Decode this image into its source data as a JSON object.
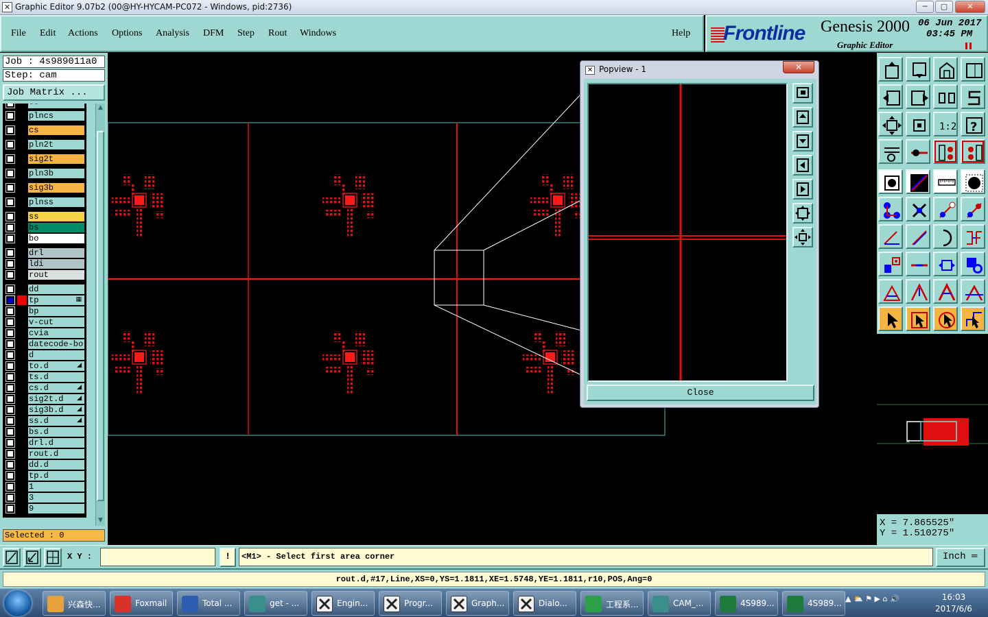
{
  "window": {
    "title": "Graphic Editor 9.07b2 (00@HY-HYCAM-PC072 - Windows, pid:2736)",
    "minimize": "─",
    "maximize": "▢",
    "close": "✕"
  },
  "menu": {
    "items": [
      "File",
      "Edit",
      "Actions",
      "Options",
      "Analysis",
      "DFM",
      "Step",
      "Rout",
      "Windows"
    ],
    "help": "Help"
  },
  "logo": {
    "brand": "Frontline",
    "product": "Genesis 2000",
    "subtitle": "Graphic Editor",
    "date": "06 Jun 2017",
    "time": "03:45 PM"
  },
  "job": {
    "job_line": "Job : 4s989011a0",
    "step_line": "Step: cam",
    "matrix_button": "Job Matrix ..."
  },
  "layers": [
    {
      "name": "--",
      "color": "#9fd8d2"
    },
    {
      "name": "plncs",
      "color": "#9fd8d2"
    },
    {
      "name": "cs",
      "color": "#f6b445"
    },
    {
      "name": "pln2t",
      "color": "#9fd8d2"
    },
    {
      "name": "sig2t",
      "color": "#f6b445"
    },
    {
      "name": "pln3b",
      "color": "#9fd8d2"
    },
    {
      "name": "sig3b",
      "color": "#f6b445"
    },
    {
      "name": "plnss",
      "color": "#9fd8d2"
    },
    {
      "name": "ss",
      "color": "#f6d445"
    },
    {
      "name": "bs",
      "color": "#008b6b"
    },
    {
      "name": "bo",
      "color": "#ffffff"
    },
    {
      "name": "drl",
      "color": "#b0c4c8"
    },
    {
      "name": "ldi",
      "color": "#b0c4c8"
    },
    {
      "name": "rout",
      "color": "#d8e0e0"
    },
    {
      "name": "dd",
      "color": "#9fd8d2"
    },
    {
      "name": "tp",
      "color": "#9fd8d2",
      "selected": true,
      "mark": "▦"
    },
    {
      "name": "bp",
      "color": "#9fd8d2"
    },
    {
      "name": "v-cut",
      "color": "#9fd8d2"
    },
    {
      "name": "cvia",
      "color": "#9fd8d2"
    },
    {
      "name": "datecode-bo",
      "color": "#9fd8d2"
    },
    {
      "name": "d",
      "color": "#9fd8d2"
    },
    {
      "name": "to.d",
      "color": "#9fd8d2",
      "mark": "◢"
    },
    {
      "name": "ts.d",
      "color": "#9fd8d2"
    },
    {
      "name": "cs.d",
      "color": "#9fd8d2",
      "mark": "◢"
    },
    {
      "name": "sig2t.d",
      "color": "#9fd8d2",
      "mark": "◢"
    },
    {
      "name": "sig3b.d",
      "color": "#9fd8d2",
      "mark": "◢"
    },
    {
      "name": "ss.d",
      "color": "#9fd8d2",
      "mark": "◢"
    },
    {
      "name": "bs.d",
      "color": "#9fd8d2"
    },
    {
      "name": "drl.d",
      "color": "#9fd8d2"
    },
    {
      "name": "rout.d",
      "color": "#9fd8d2"
    },
    {
      "name": "dd.d",
      "color": "#9fd8d2"
    },
    {
      "name": "tp.d",
      "color": "#9fd8d2"
    },
    {
      "name": "1",
      "color": "#9fd8d2"
    },
    {
      "name": "3",
      "color": "#9fd8d2"
    },
    {
      "name": "9",
      "color": "#9fd8d2"
    }
  ],
  "selected_count": "Selected : 0",
  "popview": {
    "title": "Popview - 1",
    "close_button": "Close",
    "close_x": "✕"
  },
  "coords": {
    "x": "X = 7.865525\"",
    "y": "Y = 1.510275\""
  },
  "command": {
    "xy_label": "X Y :",
    "xy_value": "",
    "bang": "!",
    "prompt": "<M1> - Select first area corner",
    "unit": "Inch ═"
  },
  "status": "rout.d,#17,Line,XS=0,YS=1.1811,XE=1.5748,YE=1.1811,r10,POS,Ang=0",
  "taskbar": {
    "tasks": [
      {
        "label": "兴森快...",
        "icon": "shell-icon",
        "color": "#e8a23a"
      },
      {
        "label": "Foxmail",
        "icon": "foxmail-icon",
        "color": "#d8322a"
      },
      {
        "label": "Total ...",
        "icon": "floppy-icon",
        "color": "#2d5fb0"
      },
      {
        "label": "get - ...",
        "icon": "eye-icon",
        "color": "#3a8f8a"
      },
      {
        "label": "Engin...",
        "icon": "xwin-icon",
        "color": "#f0f0f0"
      },
      {
        "label": "Progr...",
        "icon": "xwin-icon",
        "color": "#f0f0f0"
      },
      {
        "label": "Graph...",
        "icon": "xwin-icon",
        "color": "#f0f0f0"
      },
      {
        "label": "Dialo...",
        "icon": "xwin-icon",
        "color": "#f0f0f0"
      },
      {
        "label": "工程系...",
        "icon": "f-logo-icon",
        "color": "#2fa04a"
      },
      {
        "label": "CAM_...",
        "icon": "cam-icon",
        "color": "#3a8f8a"
      },
      {
        "label": "4S989...",
        "icon": "excel-icon",
        "color": "#1e7a3c"
      },
      {
        "label": "4S989...",
        "icon": "excel-icon",
        "color": "#1e7a3c"
      }
    ],
    "tray": "▲ ⛅ ⚑ ▶ ⌂ 🔊",
    "time": "16:03",
    "date": "2017/6/6"
  }
}
